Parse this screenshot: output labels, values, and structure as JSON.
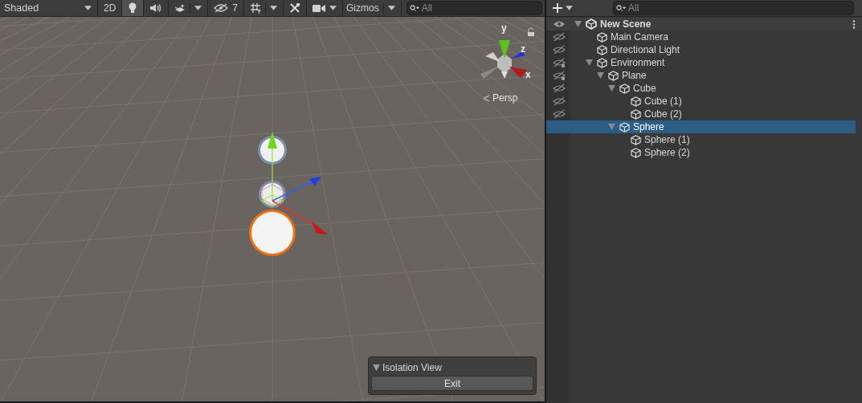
{
  "scene_toolbar": {
    "shading": "Shaded",
    "mode_2d": {
      "label": "2D",
      "on": false
    },
    "toggles": [
      {
        "kind": "lighting",
        "on": true
      },
      {
        "kind": "audio",
        "on": false
      },
      {
        "kind": "effects",
        "on": false
      }
    ],
    "hidden_count": "7",
    "gizmos": "Gizmos",
    "search": {
      "placeholder": "All"
    }
  },
  "scene_view": {
    "axes": {
      "y": "y",
      "z": "z",
      "x": "x"
    },
    "projection": "Persp",
    "isolation_panel": {
      "title": "Isolation View",
      "button": "Exit"
    }
  },
  "hierarchy": {
    "search": {
      "placeholder": "All"
    },
    "tree": [
      {
        "name": "New Scene",
        "kind": "scene",
        "hidden": false,
        "expanded": true,
        "selected": false,
        "children": [
          {
            "name": "Main Camera",
            "kind": "object",
            "hidden": true,
            "mixed": false,
            "selected": false
          },
          {
            "name": "Directional Light",
            "kind": "object",
            "hidden": true,
            "mixed": false,
            "selected": false
          },
          {
            "name": "Environment",
            "kind": "object",
            "hidden": true,
            "mixed": true,
            "expanded": true,
            "selected": false,
            "children": [
              {
                "name": "Plane",
                "kind": "object",
                "hidden": true,
                "mixed": true,
                "expanded": true,
                "selected": false,
                "children": [
                  {
                    "name": "Cube",
                    "kind": "object",
                    "hidden": true,
                    "mixed": false,
                    "expanded": true,
                    "selected": false,
                    "children": [
                      {
                        "name": "Cube (1)",
                        "kind": "object",
                        "hidden": true,
                        "mixed": false,
                        "selected": false
                      },
                      {
                        "name": "Cube (2)",
                        "kind": "object",
                        "hidden": true,
                        "mixed": false,
                        "selected": false
                      }
                    ]
                  },
                  {
                    "name": "Sphere",
                    "kind": "object",
                    "expanded": true,
                    "selected": true,
                    "children": [
                      {
                        "name": "Sphere (1)",
                        "kind": "object",
                        "selected": false
                      },
                      {
                        "name": "Sphere (2)",
                        "kind": "object",
                        "selected": false
                      }
                    ]
                  }
                ]
              }
            ]
          }
        ]
      }
    ]
  }
}
